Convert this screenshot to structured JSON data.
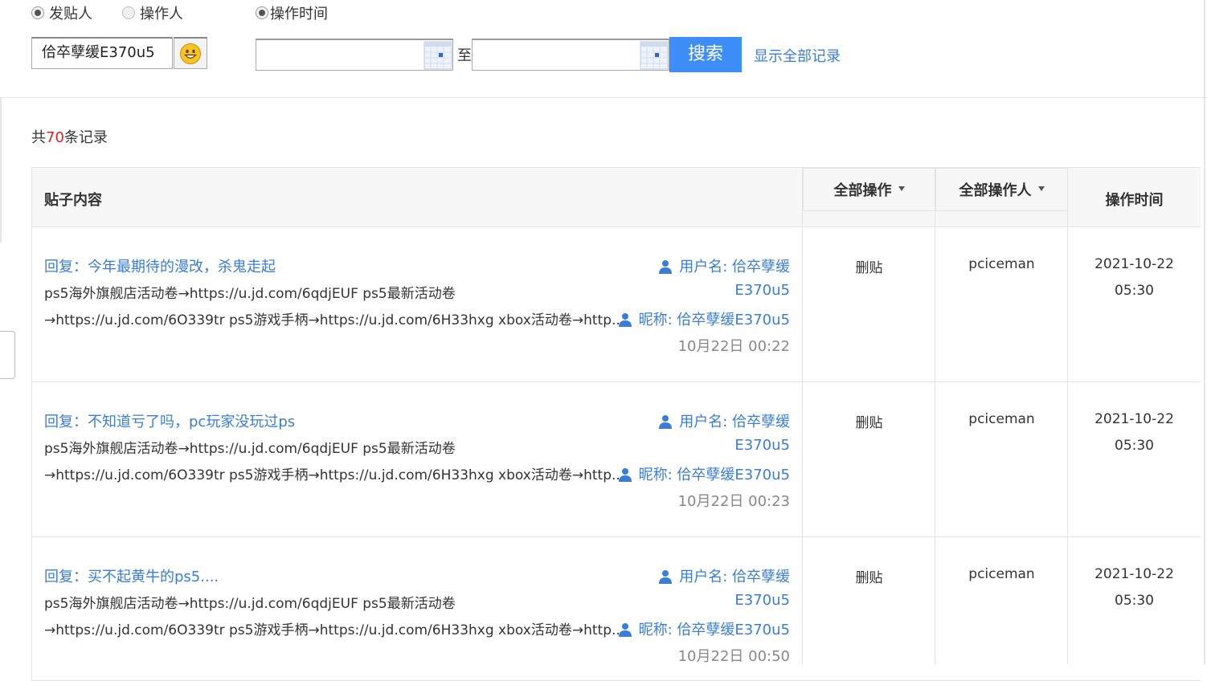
{
  "filters": {
    "radios": [
      {
        "label": "发贴人",
        "checked": true
      },
      {
        "label": "操作人",
        "checked": false
      },
      {
        "label": "操作时间",
        "checked": true
      }
    ],
    "name_value": "佮卒孽缓E370u5",
    "date_from": "",
    "date_to": "",
    "to_label": "至",
    "search_label": "搜索",
    "show_all_label": "显示全部记录"
  },
  "summary": {
    "prefix": "共",
    "count": "70",
    "suffix": "条记录"
  },
  "table": {
    "headers": {
      "content": "贴子内容",
      "operation": "全部操作",
      "operator": "全部操作人",
      "time": "操作时间"
    },
    "rows": [
      {
        "title": "回复：今年最期待的漫改，杀鬼走起",
        "line1": "ps5海外旗舰店活动卷→https://u.jd.com/6qdjEUF ps5最新活动卷",
        "line2": "→https://u.jd.com/6O339tr ps5游戏手柄→https://u.jd.com/6H33hxg xbox活动卷→http...",
        "username_line1": "用户名: 佮卒孽缓",
        "username_line2": "E370u5",
        "nickname": "昵称: 佮卒孽缓E370u5",
        "post_time": "10月22日 00:22",
        "operation": "删贴",
        "operator": "pciceman",
        "op_date": "2021-10-22",
        "op_time": "05:30"
      },
      {
        "title": "回复：不知道亏了吗，pc玩家没玩过ps",
        "line1": "ps5海外旗舰店活动卷→https://u.jd.com/6qdjEUF ps5最新活动卷",
        "line2": "→https://u.jd.com/6O339tr ps5游戏手柄→https://u.jd.com/6H33hxg xbox活动卷→http...",
        "username_line1": "用户名: 佮卒孽缓",
        "username_line2": "E370u5",
        "nickname": "昵称: 佮卒孽缓E370u5",
        "post_time": "10月22日 00:23",
        "operation": "删贴",
        "operator": "pciceman",
        "op_date": "2021-10-22",
        "op_time": "05:30"
      },
      {
        "title": "回复：买不起黄牛的ps5....",
        "line1": "ps5海外旗舰店活动卷→https://u.jd.com/6qdjEUF ps5最新活动卷",
        "line2": "→https://u.jd.com/6O339tr ps5游戏手柄→https://u.jd.com/6H33hxg xbox活动卷→http...",
        "username_line1": "用户名: 佮卒孽缓",
        "username_line2": "E370u5",
        "nickname": "昵称: 佮卒孽缓E370u5",
        "post_time": "10月22日 00:50",
        "operation": "删贴",
        "operator": "pciceman",
        "op_date": "2021-10-22",
        "op_time": "05:30"
      }
    ]
  },
  "colors": {
    "accent": "#3d8ef8",
    "link": "#3a7dd8",
    "count": "#e02020"
  }
}
